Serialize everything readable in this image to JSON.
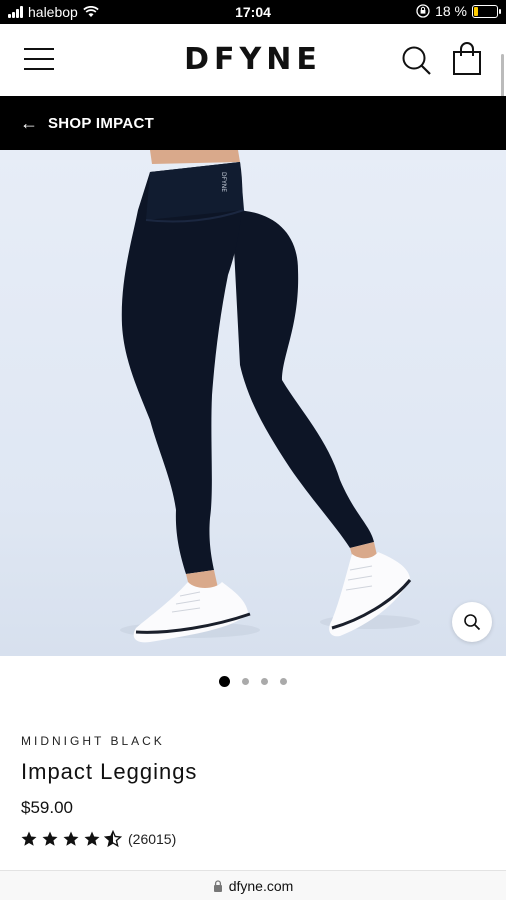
{
  "status_bar": {
    "carrier": "halebop",
    "time": "17:04",
    "battery": "18 %",
    "battery_level": 0.18
  },
  "header": {
    "logo": "DFYNE"
  },
  "back_link": {
    "label": "SHOP IMPACT"
  },
  "gallery": {
    "image_count": 4,
    "active_index": 0
  },
  "product": {
    "color": "MIDNIGHT BLACK",
    "title": "Impact Leggings",
    "price": "$59.00",
    "rating": 4.5,
    "review_count": "(26015)"
  },
  "browser": {
    "url": "dfyne.com"
  },
  "colors": {
    "accent": "#000000",
    "leggings": "#0d1526",
    "background": "#e4eaf4"
  }
}
